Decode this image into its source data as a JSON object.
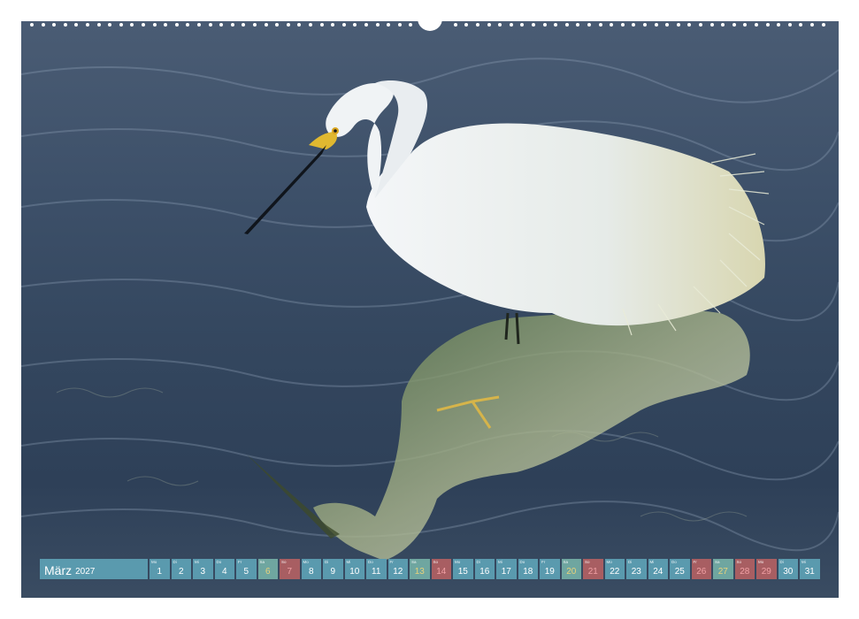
{
  "calendar": {
    "month": "März",
    "year": "2027",
    "days": [
      {
        "n": "1",
        "wd": "Mo",
        "type": "weekday"
      },
      {
        "n": "2",
        "wd": "Di",
        "type": "weekday"
      },
      {
        "n": "3",
        "wd": "Mi",
        "type": "weekday"
      },
      {
        "n": "4",
        "wd": "Do",
        "type": "weekday"
      },
      {
        "n": "5",
        "wd": "Fr",
        "type": "weekday"
      },
      {
        "n": "6",
        "wd": "Sa",
        "type": "sat"
      },
      {
        "n": "7",
        "wd": "So",
        "type": "sun"
      },
      {
        "n": "8",
        "wd": "Mo",
        "type": "weekday"
      },
      {
        "n": "9",
        "wd": "Di",
        "type": "weekday"
      },
      {
        "n": "10",
        "wd": "Mi",
        "type": "weekday"
      },
      {
        "n": "11",
        "wd": "Do",
        "type": "weekday"
      },
      {
        "n": "12",
        "wd": "Fr",
        "type": "weekday"
      },
      {
        "n": "13",
        "wd": "Sa",
        "type": "sat"
      },
      {
        "n": "14",
        "wd": "So",
        "type": "sun"
      },
      {
        "n": "15",
        "wd": "Mo",
        "type": "weekday"
      },
      {
        "n": "16",
        "wd": "Di",
        "type": "weekday"
      },
      {
        "n": "17",
        "wd": "Mi",
        "type": "weekday"
      },
      {
        "n": "18",
        "wd": "Do",
        "type": "weekday"
      },
      {
        "n": "19",
        "wd": "Fr",
        "type": "weekday"
      },
      {
        "n": "20",
        "wd": "Sa",
        "type": "sat"
      },
      {
        "n": "21",
        "wd": "So",
        "type": "sun"
      },
      {
        "n": "22",
        "wd": "Mo",
        "type": "weekday"
      },
      {
        "n": "23",
        "wd": "Di",
        "type": "weekday"
      },
      {
        "n": "24",
        "wd": "Mi",
        "type": "weekday"
      },
      {
        "n": "25",
        "wd": "Do",
        "type": "weekday"
      },
      {
        "n": "26",
        "wd": "Fr",
        "type": "sun"
      },
      {
        "n": "27",
        "wd": "Sa",
        "type": "sat"
      },
      {
        "n": "28",
        "wd": "So",
        "type": "sun"
      },
      {
        "n": "29",
        "wd": "Mo",
        "type": "sun"
      },
      {
        "n": "30",
        "wd": "Di",
        "type": "weekday"
      },
      {
        "n": "31",
        "wd": "Mi",
        "type": "weekday"
      }
    ]
  },
  "colors": {
    "cell_weekday": "#5a9aae",
    "cell_saturday": "#6fa6a0",
    "cell_sunday_holiday": "#a85e62"
  }
}
